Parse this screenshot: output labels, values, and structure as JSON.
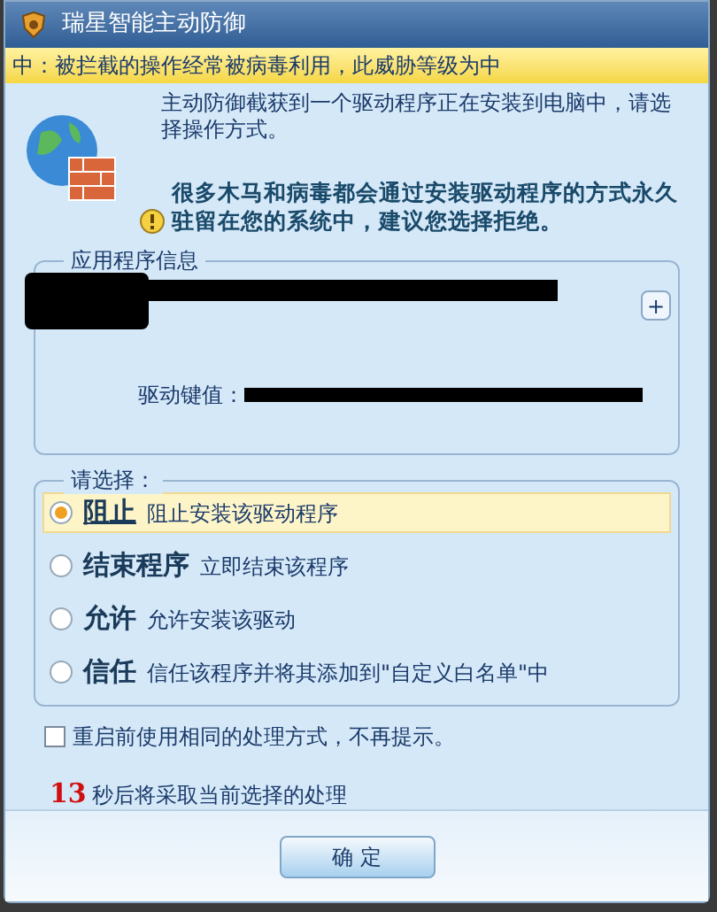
{
  "window": {
    "title": "瑞星智能主动防御"
  },
  "threat_banner": "中：被拦截的操作经常被病毒利用，此威胁等级为中",
  "message": "主动防御截获到一个驱动程序正在安装到电脑中，请选择操作方式。",
  "warning": "很多木马和病毒都会通过安装驱动程序的方式永久驻留在您的系统中，建议您选择拒绝。",
  "app_info": {
    "title": "应用程序信息",
    "expand_button": "+",
    "driver_key_label": "驱动键值："
  },
  "choices": {
    "title": "请选择：",
    "options": [
      {
        "label": "阻止",
        "description": "阻止安装该驱动程序",
        "selected": true
      },
      {
        "label": "结束程序",
        "description": "立即结束该程序",
        "selected": false
      },
      {
        "label": "允许",
        "description": "允许安装该驱动",
        "selected": false
      },
      {
        "label": "信任",
        "description": "信任该程序并将其添加到\"自定义白名单\"中",
        "selected": false
      }
    ]
  },
  "remember": {
    "label": "重启前使用相同的处理方式，不再提示。",
    "checked": false
  },
  "countdown": {
    "seconds": "13",
    "text": "秒后将采取当前选择的处理"
  },
  "ok_button": "确 定"
}
